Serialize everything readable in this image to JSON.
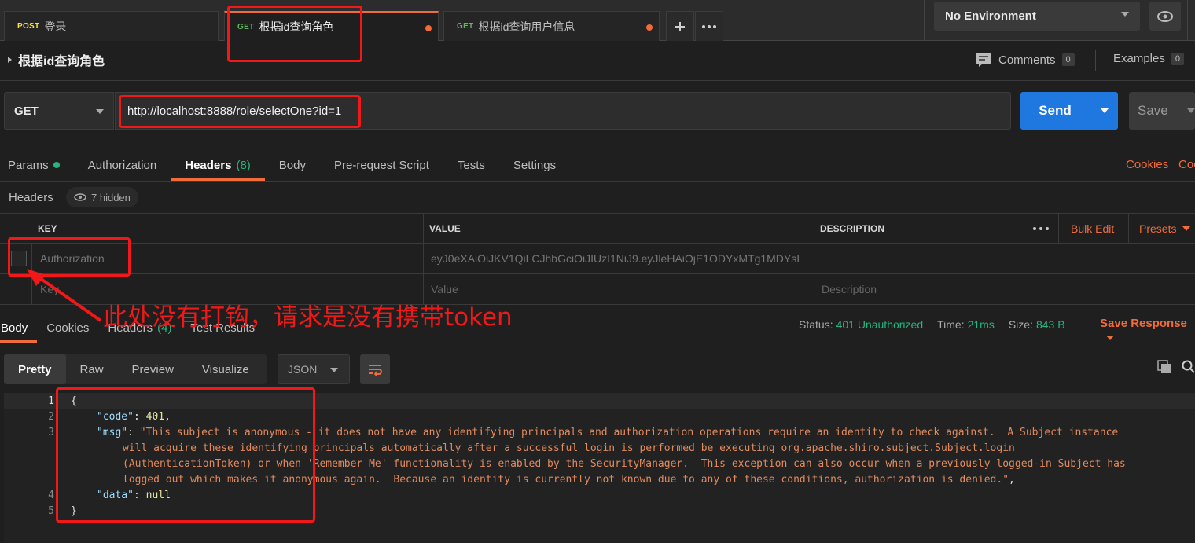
{
  "tabs": [
    {
      "method": "POST",
      "label": "登录"
    },
    {
      "method": "GET",
      "label": "根据id查询角色"
    },
    {
      "method": "GET",
      "label": "根据id查询用户信息"
    }
  ],
  "environment": {
    "selected": "No Environment"
  },
  "request": {
    "title": "根据id查询角色",
    "method": "GET",
    "url": "http://localhost:8888/role/selectOne?id=1",
    "send_label": "Send",
    "save_label": "Save"
  },
  "comments": {
    "label": "Comments",
    "count": "0"
  },
  "examples": {
    "label": "Examples",
    "count": "0"
  },
  "request_tabs": {
    "params": "Params",
    "authorization": "Authorization",
    "headers": "Headers",
    "headers_count": "(8)",
    "body": "Body",
    "prerequest": "Pre-request Script",
    "tests": "Tests",
    "settings": "Settings",
    "cookies": "Cookies",
    "code": "Coc"
  },
  "headers_section": {
    "label": "Headers",
    "hidden": "7 hidden"
  },
  "table": {
    "columns": [
      "KEY",
      "VALUE",
      "DESCRIPTION"
    ],
    "bulk_edit": "Bulk Edit",
    "presets": "Presets",
    "rows": [
      {
        "key": "Authorization",
        "value": "eyJ0eXAiOiJKV1QiLCJhbGciOiJIUzI1NiJ9.eyJleHAiOjE1ODYxMTg1MDYsI",
        "description": ""
      }
    ],
    "placeholder": {
      "key": "Key",
      "value": "Value",
      "description": "Description"
    }
  },
  "response_tabs": {
    "body": "Body",
    "cookies": "Cookies",
    "headers": "Headers",
    "headers_count": "(4)",
    "test_results": "Test Results"
  },
  "response_meta": {
    "status_label": "Status:",
    "status_value": "401 Unauthorized",
    "time_label": "Time:",
    "time_value": "21ms",
    "size_label": "Size:",
    "size_value": "843 B",
    "save_response": "Save Response"
  },
  "view_modes": [
    "Pretty",
    "Raw",
    "Preview",
    "Visualize"
  ],
  "format": "JSON",
  "code": {
    "line_numbers": [
      "1",
      "2",
      "3",
      "4",
      "5"
    ],
    "open_brace": "{",
    "close_brace": "}",
    "code_key": "\"code\"",
    "code_value": "401",
    "msg_key": "\"msg\"",
    "msg_lines": [
      "\"This subject is anonymous - it does not have any identifying principals and authorization operations require an identity to check against.  A Subject instance",
      "will acquire these identifying principals automatically after a successful login is performed be executing org.apache.shiro.subject.Subject.login",
      "(AuthenticationToken) or when 'Remember Me' functionality is enabled by the SecurityManager.  This exception can also occur when a previously logged-in Subject has",
      "logged out which makes it anonymous again.  Because an identity is currently not known due to any of these conditions, authorization is denied.\""
    ],
    "data_key": "\"data\"",
    "data_value": "null"
  },
  "annotation": "此处没有打钩，请求是没有携带token",
  "colors": {
    "accent": "#f26b3a",
    "send": "#1e78e0",
    "success": "#26b47f",
    "annotation": "#f01818"
  }
}
